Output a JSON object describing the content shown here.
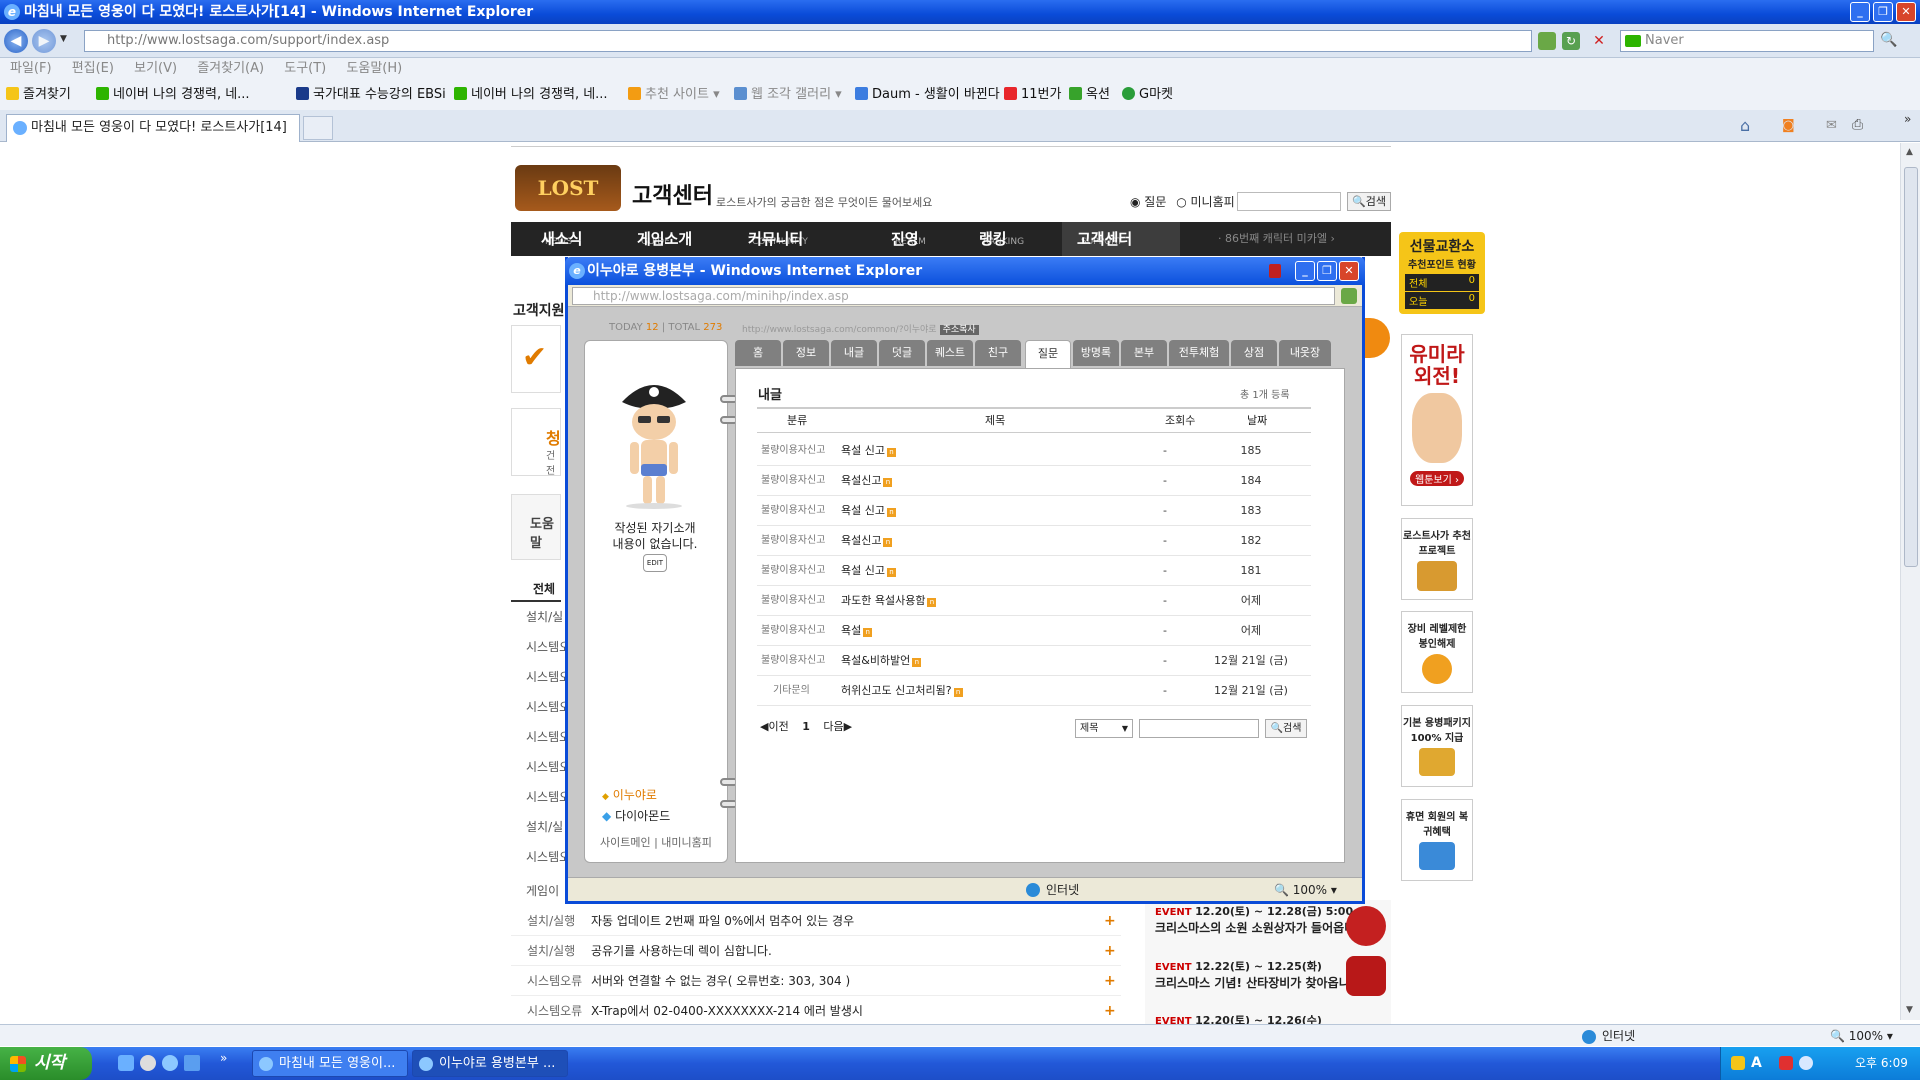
{
  "browser": {
    "window_title": "마침내 모든 영웅이 다 모였다! 로스트사가[14] - Windows Internet Explorer",
    "address": "http://www.lostsaga.com/support/index.asp",
    "address_host": "lostsaga.com",
    "search_placeholder": "Naver",
    "menu": [
      "파일(F)",
      "편집(E)",
      "보기(V)",
      "즐겨찾기(A)",
      "도구(T)",
      "도움말(H)"
    ],
    "favorites_label": "즐겨찾기",
    "favorites": [
      "네이버 나의 경쟁력, 네...",
      "국가대표 수능강의 EBSi",
      "네이버 나의 경쟁력, 네...",
      "추천 사이트",
      "웹 조각 갤러리",
      "Daum - 생활이 바뀐다",
      "11번가",
      "옥션",
      "G마켓"
    ],
    "tab_title": "마침내 모든 영웅이 다 모였다! 로스트사가[14]",
    "status_zone": "인터넷",
    "zoom": "100%"
  },
  "site": {
    "logo": "LOST SAGA",
    "title": "고객센터",
    "subtitle": "로스트사가의 궁금한 점은 무엇이든 물어보세요",
    "search_radio_1": "질문",
    "search_radio_2": "미니홈피",
    "search_button": "검색",
    "nav": [
      {
        "label": "새소식",
        "sub": "NEWS"
      },
      {
        "label": "게임소개",
        "sub": "GUIDE"
      },
      {
        "label": "커뮤니티",
        "sub": "COMMUNITY"
      },
      {
        "label": "진영",
        "sub": "REALM"
      },
      {
        "label": "랭킹",
        "sub": "RANKING"
      },
      {
        "label": "고객센터",
        "sub": "SUPPORT"
      }
    ],
    "nav_note": "· 86번째 캐릭터 미카엘 ›",
    "left_label": "고객지원",
    "left_heading_partial": "청",
    "left_sub_partial": "건전",
    "help_label": "도움말",
    "filter_all": "전체",
    "side_cats": [
      "설치/실",
      "시스템오",
      "시스템오",
      "시스템오",
      "시스템오",
      "시스템오",
      "시스템오",
      "설치/실",
      "시스템오",
      "게임이"
    ],
    "faq": [
      {
        "cat": "설치/실행",
        "title": "자동 업데이트 2번째 파일 0%에서 멈추어 있는 경우"
      },
      {
        "cat": "설치/실행",
        "title": "공유기를 사용하는데 렉이 심합니다."
      },
      {
        "cat": "시스템오류",
        "title": "서버와 연결할 수 없는 경우( 오류번호: 303, 304 )"
      },
      {
        "cat": "시스템오류",
        "title": "X-Trap에서 02-0400-XXXXXXXX-214 에러 발생시"
      }
    ],
    "events": [
      {
        "tag": "EVENT",
        "date": "12.20(토) ~ 12.28(금) 5:00",
        "title": "크리스마스의 소원 소원상자가 들어옵니다"
      },
      {
        "tag": "EVENT",
        "date": "12.22(토) ~ 12.25(화)",
        "title": "크리스마스 기념! 산타장비가 찾아옵니다~"
      },
      {
        "tag": "EVENT",
        "date": "12.20(토) ~ 12.26(수)",
        "title": ""
      }
    ],
    "right_banner": {
      "title": "선물교환소",
      "subtitle": "추천포인트 현황",
      "total_label": "전체",
      "total_value": "0",
      "today_label": "오늘",
      "today_value": "0"
    },
    "right_ads": [
      {
        "title": "유미라 외전!",
        "button": "웹툰보기 ›"
      },
      {
        "title": "로스트사가 추천 프로젝트"
      },
      {
        "title": "장비 레벨제한 봉인해제"
      },
      {
        "title": "기본 용병패키지 100% 지급"
      },
      {
        "title": "휴면 회원의 복귀혜택"
      }
    ]
  },
  "popup": {
    "window_title": "이누야로 용병본부 - Windows Internet Explorer",
    "address": "http://www.lostsaga.com/minihp/index.asp",
    "today_label": "TODAY",
    "today_value": "12",
    "total_label": "TOTAL",
    "total_value": "273",
    "url_hint": "http://www.lostsaga.com/common/?이누야로",
    "copy_button": "주소복사",
    "tabs": [
      "홈",
      "정보",
      "내글",
      "덧글",
      "퀘스트",
      "친구",
      "질문",
      "방명록",
      "본부",
      "전투체험",
      "상점",
      "내옷장"
    ],
    "active_tab": "질문",
    "intro_line1": "작성된 자기소개",
    "intro_line2": "내용이 없습니다.",
    "edit": "EDIT",
    "user_name": "이누야로",
    "user_grade": "다이아몬드",
    "links": "사이트메인 | 내미니홈피",
    "section_title": "내글",
    "total_count": "총 1개 등록",
    "columns": [
      "분류",
      "제목",
      "조회수",
      "날짜"
    ],
    "rows": [
      {
        "cat": "불량이용자신고",
        "title": "욕설 신고",
        "views": "-",
        "date": "185"
      },
      {
        "cat": "불량이용자신고",
        "title": "욕설신고",
        "views": "-",
        "date": "184"
      },
      {
        "cat": "불량이용자신고",
        "title": "욕설 신고",
        "views": "-",
        "date": "183"
      },
      {
        "cat": "불량이용자신고",
        "title": "욕설신고",
        "views": "-",
        "date": "182"
      },
      {
        "cat": "불량이용자신고",
        "title": "욕설 신고",
        "views": "-",
        "date": "181"
      },
      {
        "cat": "불량이용자신고",
        "title": "과도한 욕설사용함",
        "views": "-",
        "date": "어제"
      },
      {
        "cat": "불량이용자신고",
        "title": "욕설",
        "views": "-",
        "date": "어제"
      },
      {
        "cat": "불량이용자신고",
        "title": "욕설&비하발언",
        "views": "-",
        "date": "12월 21일 (금)"
      },
      {
        "cat": "기타문의",
        "title": "허위신고도 신고처리됨?",
        "views": "-",
        "date": "12월 21일 (금)"
      }
    ],
    "pager_prev": "◀이전",
    "pager_page": "1",
    "pager_next": "다음▶",
    "search_select": "제목",
    "search_button": "검색",
    "status_zone": "인터넷",
    "zoom": "100%"
  },
  "taskbar": {
    "start": "시작",
    "tasks": [
      "마침내 모든 영웅이...",
      "이누야로 용병본부 ..."
    ],
    "clock": "오후 6:09"
  },
  "colors": {
    "xp_blue": "#0a4bd8",
    "nav_dark": "#242424",
    "accent_orange": "#e07b00",
    "start_green": "#2a8d2a"
  }
}
